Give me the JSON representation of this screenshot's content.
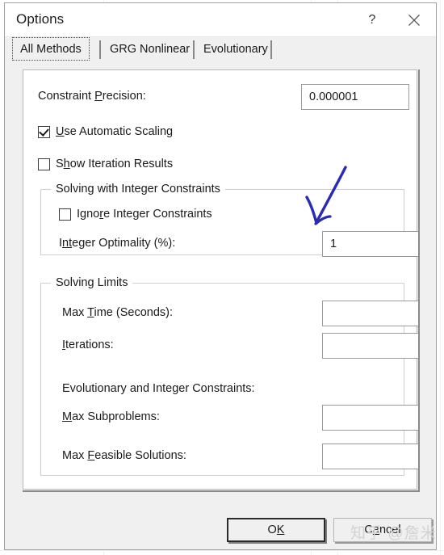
{
  "window": {
    "title": "Options",
    "help_icon": "question-mark-icon",
    "close_icon": "close-x-icon"
  },
  "tabs": [
    {
      "label": "All Methods",
      "selected": true
    },
    {
      "label": "GRG Nonlinear",
      "selected": false
    },
    {
      "label": "Evolutionary",
      "selected": false
    }
  ],
  "fields": {
    "constraint_precision": {
      "label_before": "Constraint ",
      "label_accel": "P",
      "label_after": "recision:",
      "value": "0.000001"
    },
    "use_automatic_scaling": {
      "label_before": "",
      "label_accel": "U",
      "label_after": "se Automatic Scaling",
      "checked": true
    },
    "show_iteration_results": {
      "label_before": "S",
      "label_accel": "h",
      "label_after": "ow Iteration Results",
      "checked": false
    },
    "ignore_integer_constraints": {
      "label_before": "Igno",
      "label_accel": "r",
      "label_after": "e Integer Constraints",
      "checked": false
    },
    "integer_optimality": {
      "label_before": "I",
      "label_accel": "nt",
      "label_after": "eger Optimality (%):",
      "value": "1"
    },
    "max_time": {
      "label_before": "Max ",
      "label_accel": "T",
      "label_after": "ime (Seconds):",
      "value": ""
    },
    "iterations": {
      "label_before": "",
      "label_accel": "I",
      "label_after": "terations:",
      "value": ""
    },
    "max_subproblems": {
      "label_before": "",
      "label_accel": "M",
      "label_after": "ax Subproblems:",
      "value": ""
    },
    "max_feasible_solutions": {
      "label_before": "Max ",
      "label_accel": "F",
      "label_after": "easible Solutions:",
      "value": ""
    }
  },
  "groups": {
    "integer_constraints_title": "Solving with Integer Constraints",
    "solving_limits_title": "Solving Limits",
    "evolutionary_heading": "Evolutionary and Integer Constraints:"
  },
  "footer": {
    "ok_before": "O",
    "ok_accel": "K",
    "ok_after": "",
    "cancel_before": "C",
    "cancel_accel": "a",
    "cancel_after": "ncel"
  },
  "annotation": {
    "type": "hand-drawn-arrow",
    "color": "#2a2ab4",
    "points_to": "integer-optimality-input"
  },
  "watermark": {
    "text": "知乎 @詹米"
  }
}
